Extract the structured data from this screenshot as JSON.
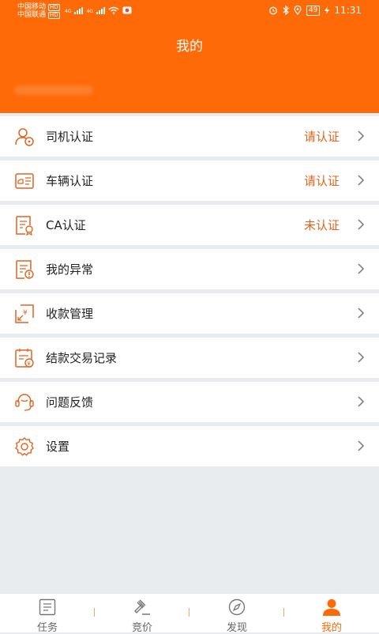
{
  "status_bar": {
    "carrier1": "中国移动",
    "carrier2": "中国联通",
    "hd": "HD",
    "network": "4G",
    "battery": "49",
    "time": "11:31"
  },
  "header": {
    "title": "我的"
  },
  "menu": [
    {
      "label": "司机认证",
      "status": "请认证",
      "icon": "driver-icon"
    },
    {
      "label": "车辆认证",
      "status": "请认证",
      "icon": "vehicle-icon"
    },
    {
      "label": "CA认证",
      "status": "未认证",
      "icon": "certificate-icon"
    },
    {
      "label": "我的异常",
      "status": "",
      "icon": "exception-icon"
    },
    {
      "label": "收款管理",
      "status": "",
      "icon": "payment-icon"
    },
    {
      "label": "结款交易记录",
      "status": "",
      "icon": "transaction-record-icon"
    },
    {
      "label": "问题反馈",
      "status": "",
      "icon": "feedback-icon"
    },
    {
      "label": "设置",
      "status": "",
      "icon": "gear-icon"
    }
  ],
  "tabs": [
    {
      "label": "任务",
      "icon": "task-icon",
      "active": false
    },
    {
      "label": "竞价",
      "icon": "gavel-icon",
      "active": false
    },
    {
      "label": "发现",
      "icon": "compass-icon",
      "active": false
    },
    {
      "label": "我的",
      "icon": "user-icon",
      "active": true
    }
  ],
  "colors": {
    "brand": "#fe6a08",
    "status_text": "#e2641f",
    "background": "#e9ecef"
  }
}
